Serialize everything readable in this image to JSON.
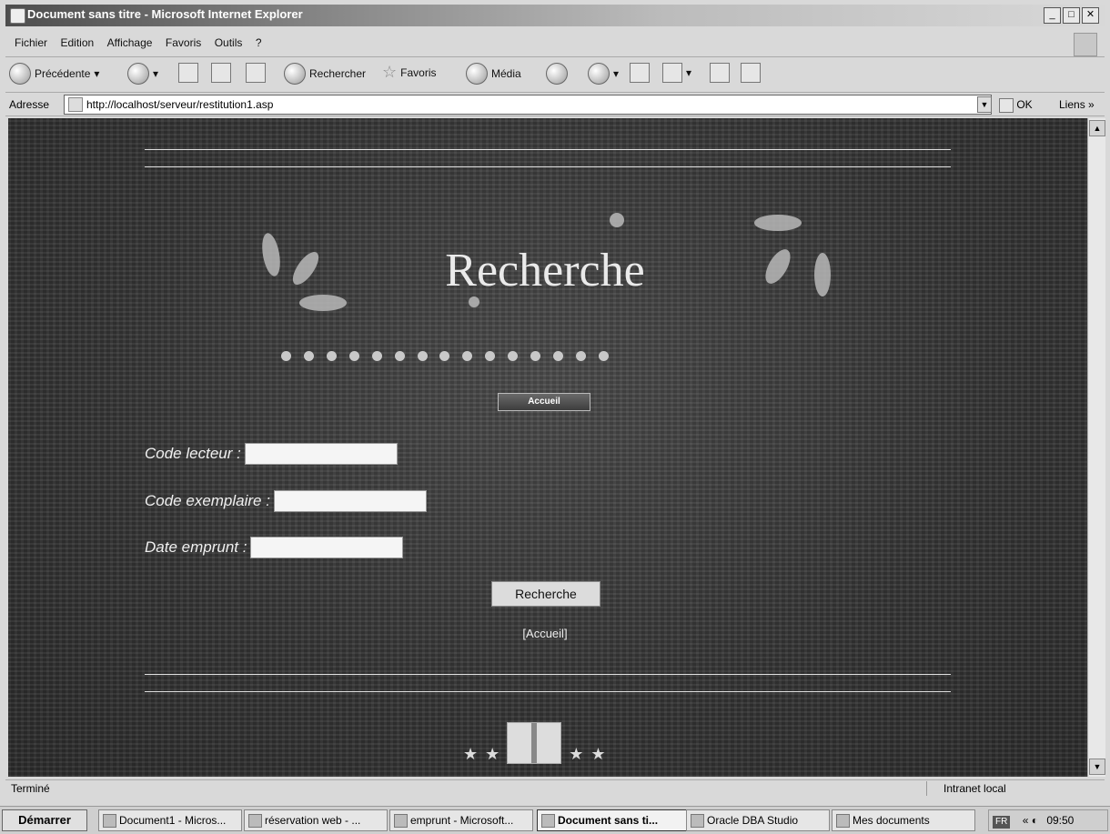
{
  "window": {
    "title": "Document sans titre - Microsoft Internet Explorer"
  },
  "menu": [
    "Fichier",
    "Edition",
    "Affichage",
    "Favoris",
    "Outils",
    "?"
  ],
  "toolbar": {
    "back": "Précédente",
    "search": "Rechercher",
    "favorites": "Favoris",
    "media": "Média"
  },
  "address": {
    "label": "Adresse",
    "url": "http://localhost/serveur/restitution1.asp",
    "go": "OK",
    "links": "Liens"
  },
  "page": {
    "heading": "Recherche",
    "accueil_button": "Accueil",
    "fields": [
      {
        "label": "Code lecteur :",
        "value": ""
      },
      {
        "label": "Code exemplaire :",
        "value": ""
      },
      {
        "label": "Date emprunt :",
        "value": ""
      }
    ],
    "submit": "Recherche",
    "home_link": "[Accueil]"
  },
  "status": {
    "text": "Terminé",
    "zone": "Intranet local"
  },
  "taskbar": {
    "start": "Démarrer",
    "tasks": [
      "Document1 - Micros...",
      "réservation web - ...",
      "emprunt - Microsoft...",
      "Document sans ti...",
      "Oracle DBA Studio",
      "Mes documents"
    ],
    "lang": "FR",
    "clock": "09:50"
  }
}
